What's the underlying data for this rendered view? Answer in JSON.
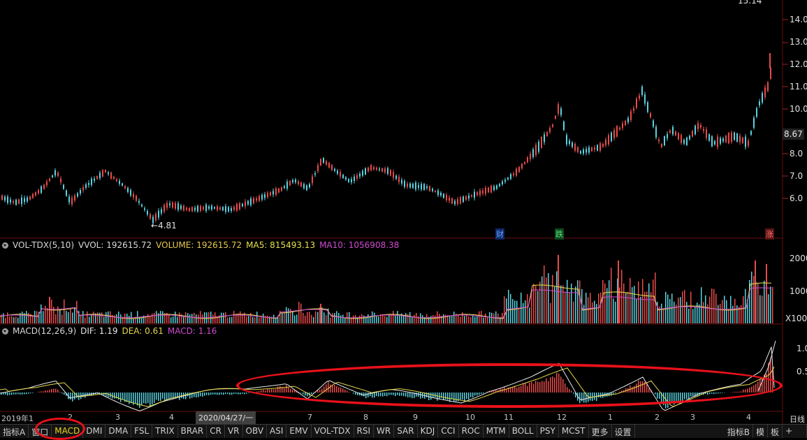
{
  "price_axis": {
    "ticks": [
      "14.0",
      "13.0",
      "12.0",
      "11.0",
      "10.0",
      "8.0",
      "7.0",
      "6.0"
    ],
    "top_clipped": "15.14",
    "current_price": "8.67",
    "low_marker": "4.81"
  },
  "event_markers": [
    {
      "label": "财",
      "color": "#4a8ef0"
    },
    {
      "label": "跌",
      "color": "#28c44a"
    },
    {
      "label": "涨",
      "color": "#e84040"
    }
  ],
  "volume_panel": {
    "title": "VOL-TDX(5,10)",
    "vvol": "VVOL: 192615.72",
    "volume": "VOLUME: 192615.72",
    "ma5": "MA5: 815493.13",
    "ma10": "MA10: 1056908.38",
    "axis": [
      "2000",
      "1000",
      "X100"
    ]
  },
  "macd_panel": {
    "title": "MACD(12,26,9)",
    "dif": "DIF: 1.19",
    "dea": "DEA: 0.61",
    "macd": "MACD: 1.16",
    "axis": [
      "1.0",
      "0.5"
    ]
  },
  "date_axis": {
    "labels": [
      "2019年1",
      "2",
      "3",
      "4",
      "7",
      "8",
      "9",
      "10",
      "11",
      "12",
      "1",
      "2",
      "3",
      "4"
    ],
    "cursor_date": "2020/04/27/一",
    "period": "日线"
  },
  "tabs": [
    "指标A",
    "窗口",
    "MACD",
    "DMI",
    "DMA",
    "FSL",
    "TRIX",
    "BRAR",
    "CR",
    "VR",
    "OBV",
    "ASI",
    "EMV",
    "VOL-TDX",
    "RSI",
    "WR",
    "SAR",
    "KDJ",
    "CCI",
    "ROC",
    "MTM",
    "BOLL",
    "PSY",
    "MCST",
    "更多",
    "设置"
  ],
  "active_tab": "MACD",
  "right_tabs": [
    "指标B",
    "模",
    "板"
  ],
  "plus_label": "+",
  "colors": {
    "up": "#e84b4b",
    "down": "#5ad2e0",
    "ma5": "#e6e04a",
    "ma10": "#d04ad0",
    "dif": "#e8e8e8",
    "dea": "#e6d84a",
    "annotation": "#e8111a",
    "active_tab": "#e8d41a"
  }
}
